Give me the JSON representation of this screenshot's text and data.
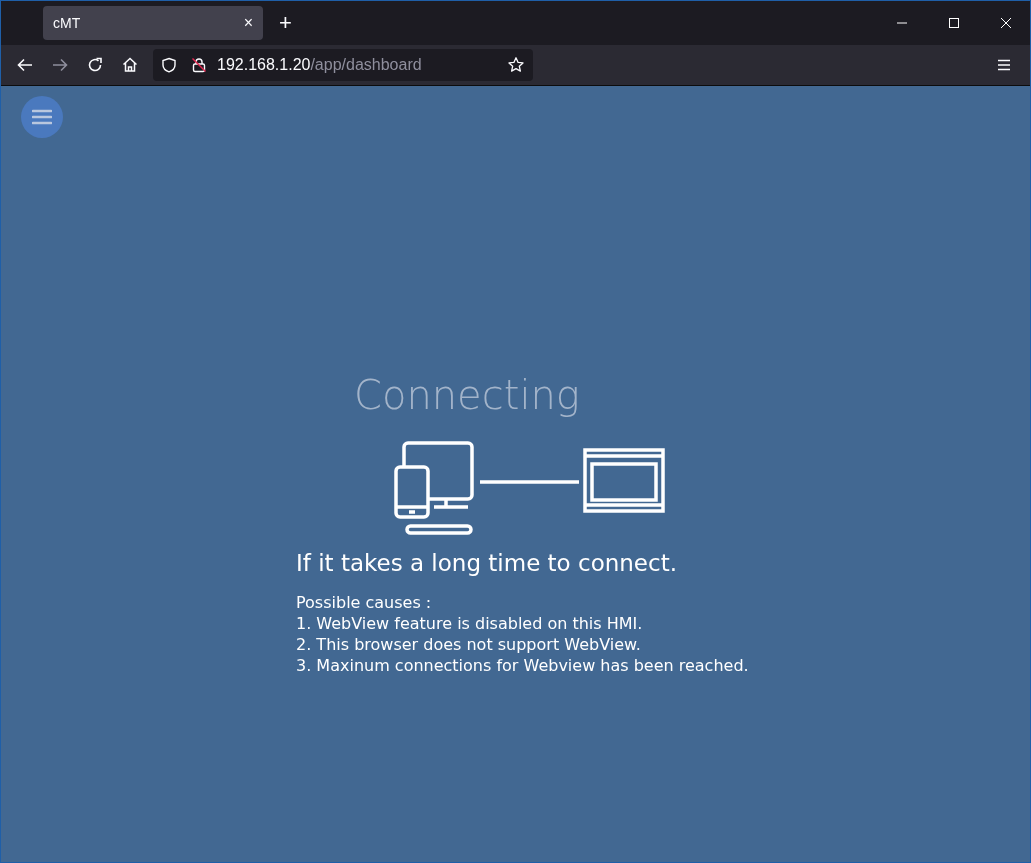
{
  "browser": {
    "tabs": [
      {
        "title": "cMT",
        "close": "×",
        "selected": true
      }
    ],
    "new_tab": "+",
    "url_host": "192.168.1.20",
    "url_path": "/app/dashboard"
  },
  "page": {
    "heading": "Connecting",
    "subheading": "If it takes a long time to connect.",
    "causes_title": "Possible causes :",
    "causes": [
      "1. WebView feature is disabled on this HMI.",
      "2. This browser does not support WebView.",
      "3. Maxinum connections for Webview has been reached."
    ]
  }
}
